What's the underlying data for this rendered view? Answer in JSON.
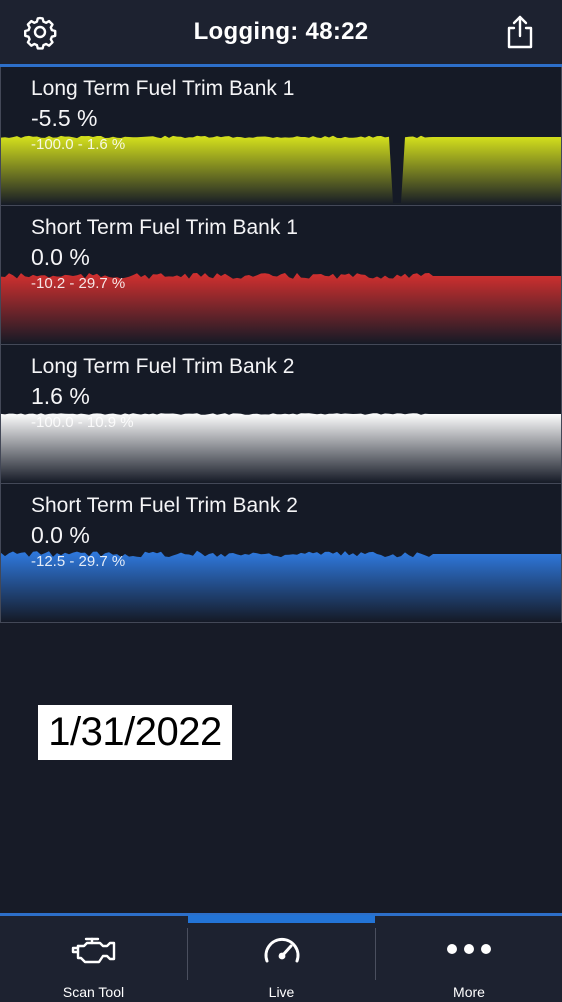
{
  "header": {
    "title": "Logging: 48:22",
    "settings_icon": "gear-icon",
    "share_icon": "share-icon"
  },
  "colors": {
    "accent": "#2d6fc9",
    "yellow": "#d6e21c",
    "red": "#d3302f",
    "white": "#ffffff",
    "blue": "#2f7ae0"
  },
  "panels": [
    {
      "name": "Long Term Fuel Trim Bank 1",
      "value": "-5.5 %",
      "range": "-100.0 - 1.6 %",
      "color": "#d6e21c",
      "min": -100.0,
      "max": 1.6
    },
    {
      "name": "Short Term Fuel Trim Bank 1",
      "value": "0.0 %",
      "range": "-10.2 - 29.7 %",
      "color": "#d3302f",
      "min": -10.2,
      "max": 29.7
    },
    {
      "name": "Long Term Fuel Trim Bank 2",
      "value": "1.6 %",
      "range": "-100.0 - 10.9 %",
      "color": "#ffffff",
      "min": -100.0,
      "max": 10.9
    },
    {
      "name": "Short Term Fuel Trim Bank 2",
      "value": "0.0 %",
      "range": "-12.5 - 29.7 %",
      "color": "#2f7ae0",
      "min": -12.5,
      "max": 29.7
    }
  ],
  "date_label": "1/31/2022",
  "tabs": [
    {
      "label": "Scan Tool",
      "icon": "engine-icon",
      "active": false
    },
    {
      "label": "Live",
      "icon": "gauge-icon",
      "active": true
    },
    {
      "label": "More",
      "icon": "more-dots-icon",
      "active": false
    }
  ]
}
